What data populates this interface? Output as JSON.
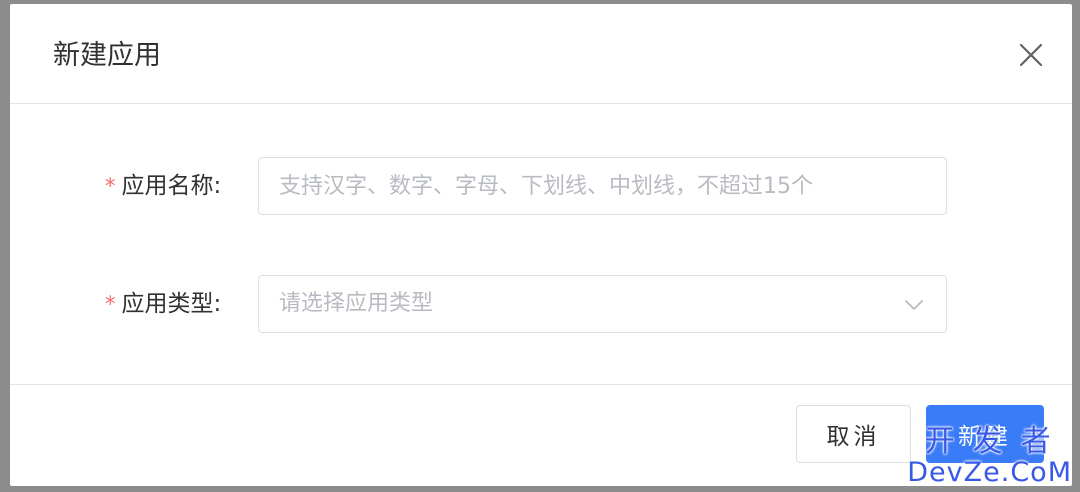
{
  "dialog": {
    "title": "新建应用",
    "close_icon": "close-icon"
  },
  "form": {
    "name_field": {
      "required_mark": "*",
      "label": "应用名称:",
      "value": "",
      "placeholder": "支持汉字、数字、字母、下划线、中划线，不超过15个"
    },
    "type_field": {
      "required_mark": "*",
      "label": "应用类型:",
      "placeholder": "请选择应用类型",
      "arrow_icon": "chevron-down-icon"
    }
  },
  "footer": {
    "cancel_label": "取消",
    "create_label": "新建"
  },
  "watermark": {
    "line1": "开发者",
    "line2": "DevZe.CoM"
  },
  "colors": {
    "primary": "#3a7cf7",
    "required": "#f56c6c",
    "overlay": "#8c8c8c"
  }
}
